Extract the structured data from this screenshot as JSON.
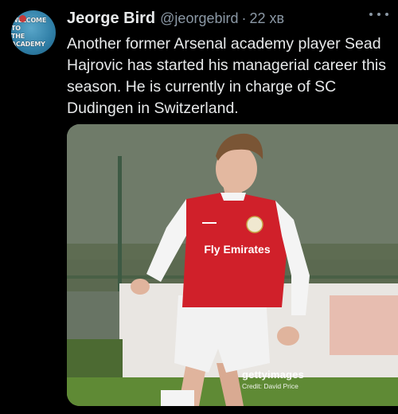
{
  "author": {
    "avatar_text": [
      "WELCOME TO",
      "THE ACADEMY"
    ],
    "name": "Jeorge Bird",
    "handle": "@jeorgebird",
    "separator": "·",
    "time": "22 хв"
  },
  "tweet": {
    "text": "Another former Arsenal academy player Sead Hajrovic has started his managerial career this season. He is currently in charge of SC Dudingen in Switzerland."
  },
  "media": {
    "shirt_text": "Fly Emirates",
    "watermark_brand": "gettyimages",
    "watermark_credit": "Credit: David Price"
  },
  "icons": {
    "more": "more-options-icon"
  },
  "colors": {
    "background": "#000000",
    "text": "#e7e9ea",
    "secondary": "#8b98a5",
    "kit_red": "#d0202a"
  }
}
